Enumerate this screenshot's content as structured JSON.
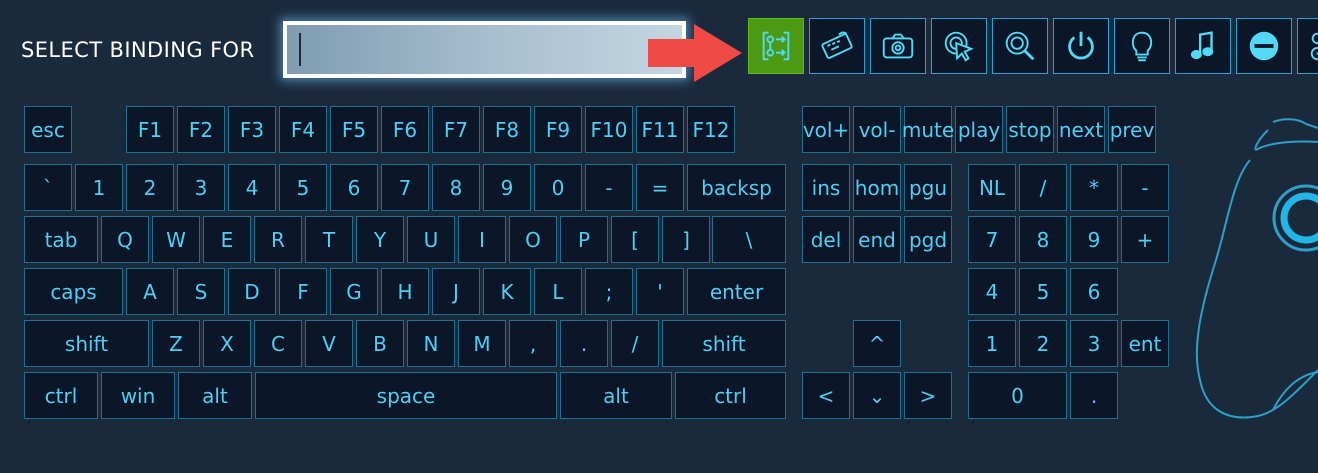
{
  "header": {
    "title": "SELECT BINDING FOR",
    "search_value": ""
  },
  "colors": {
    "background": "#1a2a3d",
    "key_bg": "#0b1628",
    "key_text": "#4fcff3",
    "active_green": "#4c9a12",
    "arrow_red": "#f04a47"
  },
  "icon_bar": [
    {
      "icon": "action-set-icon",
      "active": true
    },
    {
      "icon": "keyboard-icon",
      "active": false
    },
    {
      "icon": "camera-icon",
      "active": false
    },
    {
      "icon": "mouse-click-icon",
      "active": false
    },
    {
      "icon": "magnifier-icon",
      "active": false
    },
    {
      "icon": "power-icon",
      "active": false
    },
    {
      "icon": "lightbulb-icon",
      "active": false
    },
    {
      "icon": "music-note-icon",
      "active": false
    },
    {
      "icon": "minus-circle-icon",
      "active": false
    },
    {
      "icon": "controller-bindings-icon",
      "active": false
    }
  ],
  "keyboard": {
    "fn_row": [
      "esc",
      "F1",
      "F2",
      "F3",
      "F4",
      "F5",
      "F6",
      "F7",
      "F8",
      "F9",
      "F10",
      "F11",
      "F12"
    ],
    "media": [
      "vol+",
      "vol-",
      "mute",
      "play",
      "stop",
      "next",
      "prev"
    ],
    "row1": [
      "`",
      "1",
      "2",
      "3",
      "4",
      "5",
      "6",
      "7",
      "8",
      "9",
      "0",
      "-",
      "=",
      "backsp"
    ],
    "row2": [
      "tab",
      "Q",
      "W",
      "E",
      "R",
      "T",
      "Y",
      "U",
      "I",
      "O",
      "P",
      "[",
      "]",
      "\\"
    ],
    "row3": [
      "caps",
      "A",
      "S",
      "D",
      "F",
      "G",
      "H",
      "J",
      "K",
      "L",
      ";",
      "'",
      "enter"
    ],
    "row4": [
      "shift",
      "Z",
      "X",
      "C",
      "V",
      "B",
      "N",
      "M",
      ",",
      ".",
      "/",
      "shift"
    ],
    "row5": [
      "ctrl",
      "win",
      "alt",
      "space",
      "alt",
      "ctrl"
    ],
    "nav1": [
      "ins",
      "hom",
      "pgu"
    ],
    "nav2": [
      "del",
      "end",
      "pgd"
    ],
    "arrows": [
      "^",
      "<",
      "⌄",
      ">"
    ],
    "numpad": [
      "NL",
      "/",
      "*",
      "-",
      "7",
      "8",
      "9",
      "+",
      "4",
      "5",
      "6",
      "1",
      "2",
      "3",
      "ent",
      "0",
      "."
    ]
  }
}
